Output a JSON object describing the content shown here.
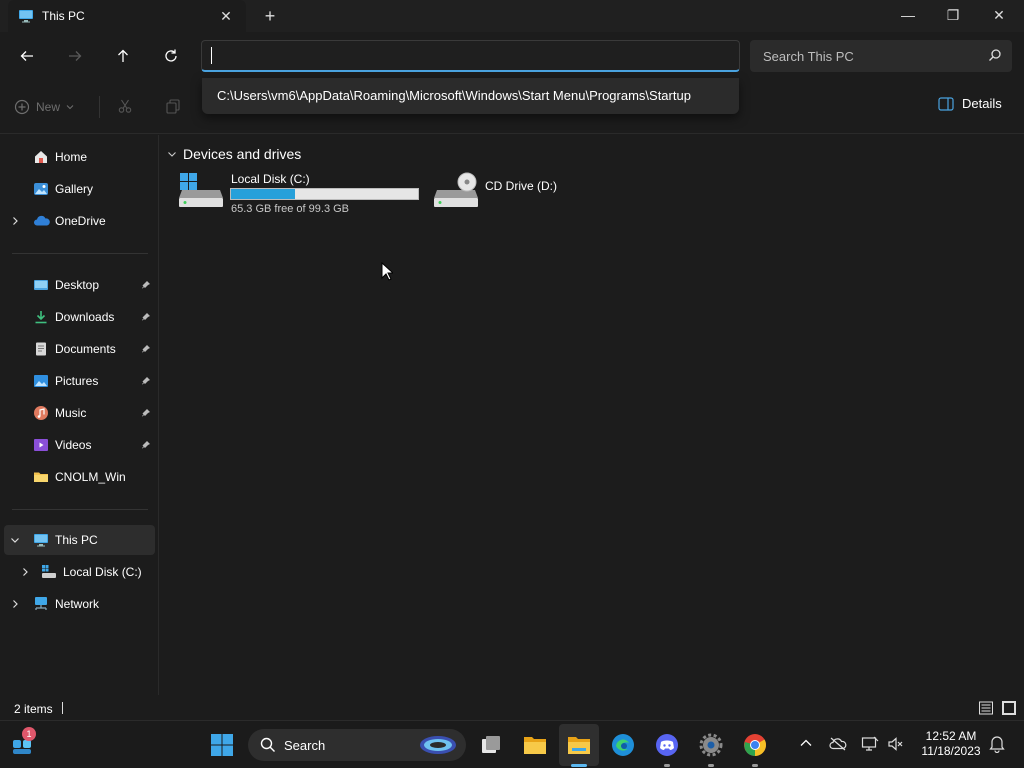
{
  "window": {
    "tab_title": "This PC",
    "close_tab": "✕",
    "new_tab": "+",
    "minimize": "—",
    "maximize": "❐",
    "close": "✕"
  },
  "nav": {
    "address_value": "",
    "search_placeholder": "Search This PC"
  },
  "address_suggestion": "C:\\Users\\vm6\\AppData\\Roaming\\Microsoft\\Windows\\Start Menu\\Programs\\Startup",
  "command_bar": {
    "new_label": "New",
    "details_label": "Details"
  },
  "sidebar": {
    "items": [
      {
        "label": "Home",
        "icon": "home-icon"
      },
      {
        "label": "Gallery",
        "icon": "gallery-icon"
      },
      {
        "label": "OneDrive",
        "icon": "cloud-icon"
      },
      {
        "label": "Desktop",
        "icon": "desktop-icon"
      },
      {
        "label": "Downloads",
        "icon": "download-icon"
      },
      {
        "label": "Documents",
        "icon": "documents-icon"
      },
      {
        "label": "Pictures",
        "icon": "pictures-icon"
      },
      {
        "label": "Music",
        "icon": "music-icon"
      },
      {
        "label": "Videos",
        "icon": "videos-icon"
      },
      {
        "label": "CNOLM_Win",
        "icon": "folder-icon"
      },
      {
        "label": "This PC",
        "icon": "computer-icon"
      },
      {
        "label": "Local Disk (C:)",
        "icon": "drive-icon"
      },
      {
        "label": "Network",
        "icon": "network-icon"
      }
    ]
  },
  "main": {
    "group_title": "Devices and drives",
    "drives": [
      {
        "label": "Local Disk (C:)",
        "free_text": "65.3 GB free of 99.3 GB",
        "used_fraction": 0.342
      },
      {
        "label": "CD Drive (D:)"
      }
    ]
  },
  "status": {
    "items_count": "2 items"
  },
  "taskbar": {
    "search_label": "Search",
    "notification_count": "1",
    "time": "12:52 AM",
    "date": "11/18/2023"
  },
  "colors": {
    "accent": "#4aa3e0",
    "drive_bar": "#26a0da",
    "background": "#1c1c1c"
  }
}
